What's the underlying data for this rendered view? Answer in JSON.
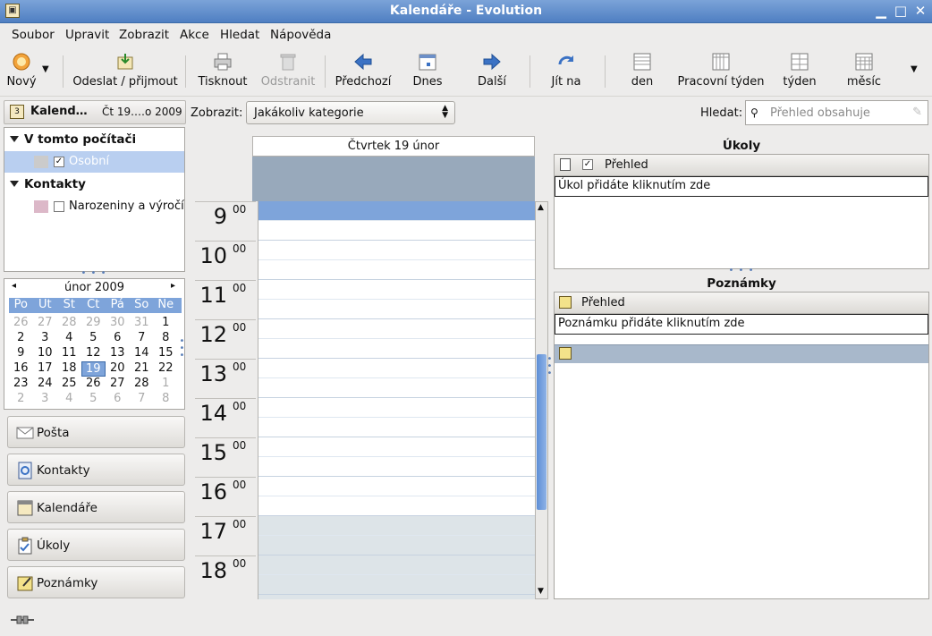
{
  "window": {
    "title": "Kalendáře - Evolution"
  },
  "menu": [
    "Soubor",
    "Upravit",
    "Zobrazit",
    "Akce",
    "Hledat",
    "Nápověda"
  ],
  "toolbar": {
    "new": "Nový",
    "send_receive": "Odeslat / přijmout",
    "print": "Tisknout",
    "delete": "Odstranit",
    "previous": "Předchozí",
    "today": "Dnes",
    "next": "Další",
    "goto": "Jít na",
    "day": "den",
    "work_week": "Pracovní týden",
    "week": "týden",
    "month": "měsíc"
  },
  "calendar_header": {
    "title": "Kalend…",
    "date": "Čt 19.…o 2009"
  },
  "sources": {
    "group1": "V tomto počítači",
    "personal": "Osobní",
    "group2": "Kontakty",
    "birthdays": "Narozeniny a výročí"
  },
  "minical": {
    "month": "únor 2009",
    "weekdays": [
      "Po",
      "Út",
      "St",
      "Čt",
      "Pá",
      "So",
      "Ne"
    ],
    "weeks": [
      [
        "26",
        "27",
        "28",
        "29",
        "30",
        "31",
        "1"
      ],
      [
        "2",
        "3",
        "4",
        "5",
        "6",
        "7",
        "8"
      ],
      [
        "9",
        "10",
        "11",
        "12",
        "13",
        "14",
        "15"
      ],
      [
        "16",
        "17",
        "18",
        "19",
        "20",
        "21",
        "22"
      ],
      [
        "23",
        "24",
        "25",
        "26",
        "27",
        "28",
        "1"
      ],
      [
        "2",
        "3",
        "4",
        "5",
        "6",
        "7",
        "8"
      ]
    ],
    "selected": "19"
  },
  "switcher": [
    "Pošta",
    "Kontakty",
    "Kalendáře",
    "Úkoly",
    "Poznámky"
  ],
  "filter": {
    "show_label": "Zobrazit:",
    "show_value": "Jakákoliv kategorie",
    "search_label": "Hledat:",
    "search_placeholder": "Přehled obsahuje"
  },
  "day_view": {
    "header": "Čtvrtek 19 únor",
    "hours": [
      "9",
      "10",
      "11",
      "12",
      "13",
      "14",
      "15",
      "16",
      "17",
      "18"
    ],
    "minutes": "00"
  },
  "tasks": {
    "title": "Úkoly",
    "column": "Přehled",
    "click_to_add": "Úkol přidáte kliknutím zde"
  },
  "memos": {
    "title": "Poznámky",
    "column": "Přehled",
    "click_to_add": "Poznámku přidáte kliknutím zde"
  },
  "colors": {
    "accent": "#7ea4da",
    "allday": "#98a9bb",
    "selected_slot": "#7ea4da"
  }
}
